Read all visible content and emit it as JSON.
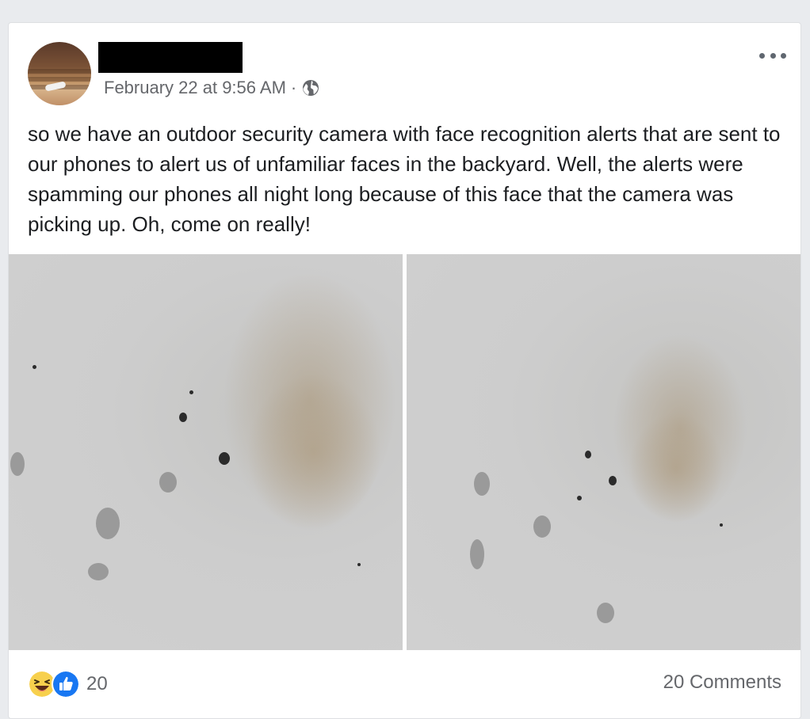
{
  "post": {
    "timestamp": "February 22 at 9:56 AM",
    "separator": "·",
    "privacy_icon": "globe-icon",
    "more_icon": "more-options-icon",
    "text": "so we have an outdoor security camera with face recognition alerts that are sent to our phones to alert us of unfamiliar faces in the backyard. Well, the alerts were spamming our phones all night long because of this face that the camera was picking up. Oh, come on really!",
    "photos": [
      {
        "label": "photo-1"
      },
      {
        "label": "photo-2"
      }
    ]
  },
  "footer": {
    "reaction_icons": [
      "haha-icon",
      "like-icon"
    ],
    "reaction_count": "20",
    "comments": "20 Comments"
  },
  "colors": {
    "background": "#e9ebee",
    "card": "#ffffff",
    "text": "#1c1e21",
    "secondary_text": "#65676b",
    "like_blue": "#1877f2",
    "haha_yellow": "#f7d04d"
  }
}
